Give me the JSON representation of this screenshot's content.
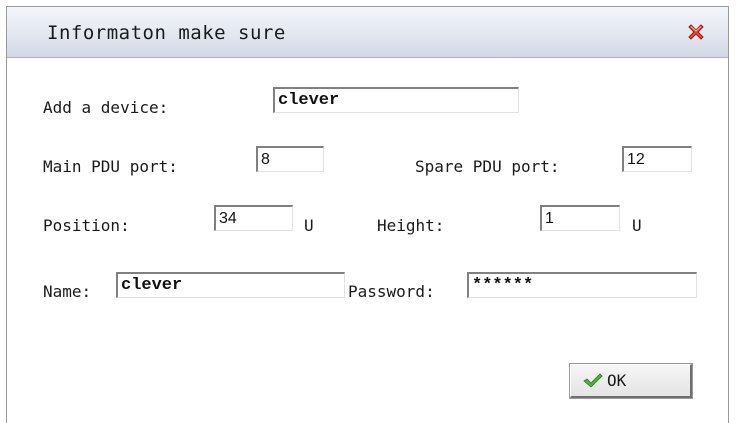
{
  "dialog": {
    "title": "Informaton make sure",
    "close_icon": "close-x-icon",
    "close_color": "#d63a2a"
  },
  "form": {
    "add_device": {
      "label": "Add a device:",
      "value": "clever"
    },
    "main_pdu_port": {
      "label": "Main PDU port:",
      "value": "8"
    },
    "spare_pdu_port": {
      "label": "Spare PDU port:",
      "value": "12"
    },
    "position": {
      "label": "Position:",
      "value": "34",
      "unit": "U"
    },
    "height": {
      "label": "Height:",
      "value": "1",
      "unit": "U"
    },
    "name": {
      "label": "Name:",
      "value": "clever"
    },
    "password": {
      "label": "Password:",
      "value": "******"
    }
  },
  "buttons": {
    "ok_label": "OK",
    "ok_icon": "checkmark-icon",
    "ok_icon_color": "#3aa52a"
  }
}
